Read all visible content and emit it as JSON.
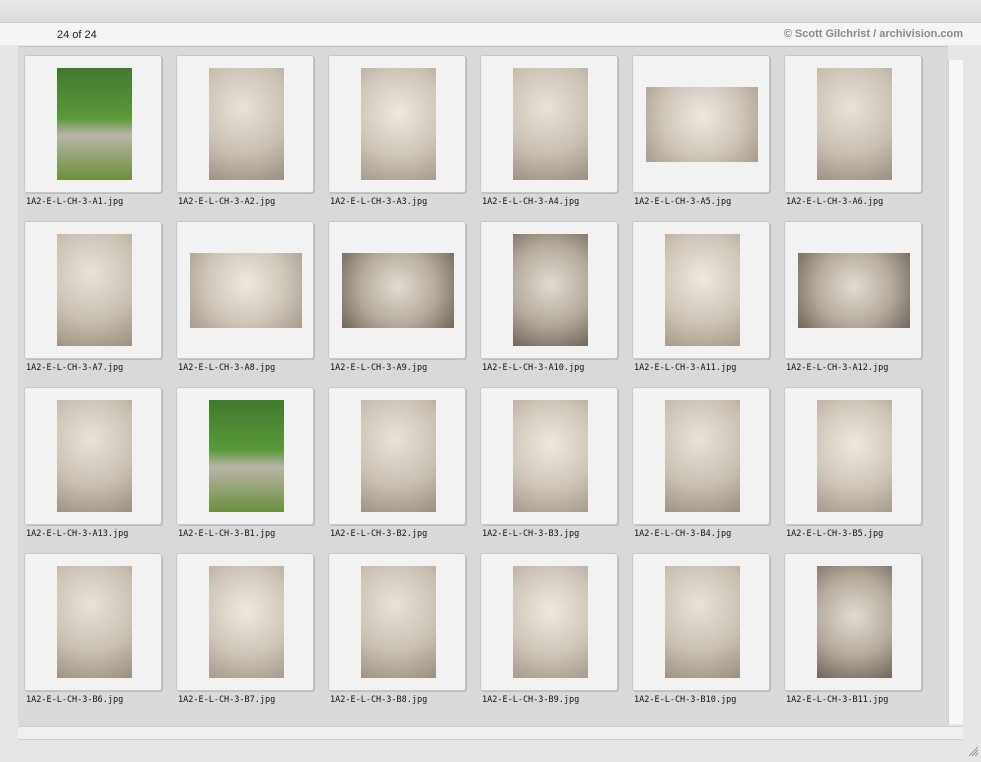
{
  "header": {
    "count": "24 of 24",
    "credit": "© Scott Gilchrist / archivision.com"
  },
  "grid": {
    "items": [
      {
        "filename": "1A2-E-L-CH-3-A1.jpg",
        "thumb": "urn-garden-photo"
      },
      {
        "filename": "1A2-E-L-CH-3-A2.jpg",
        "thumb": "relief-photo"
      },
      {
        "filename": "1A2-E-L-CH-3-A3.jpg",
        "thumb": "relief-photo"
      },
      {
        "filename": "1A2-E-L-CH-3-A4.jpg",
        "thumb": "relief-photo"
      },
      {
        "filename": "1A2-E-L-CH-3-A5.jpg",
        "thumb": "relief-photo"
      },
      {
        "filename": "1A2-E-L-CH-3-A6.jpg",
        "thumb": "relief-photo"
      },
      {
        "filename": "1A2-E-L-CH-3-A7.jpg",
        "thumb": "relief-photo"
      },
      {
        "filename": "1A2-E-L-CH-3-A8.jpg",
        "thumb": "relief-photo"
      },
      {
        "filename": "1A2-E-L-CH-3-A9.jpg",
        "thumb": "relief-photo"
      },
      {
        "filename": "1A2-E-L-CH-3-A10.jpg",
        "thumb": "relief-photo"
      },
      {
        "filename": "1A2-E-L-CH-3-A11.jpg",
        "thumb": "relief-photo"
      },
      {
        "filename": "1A2-E-L-CH-3-A12.jpg",
        "thumb": "relief-photo"
      },
      {
        "filename": "1A2-E-L-CH-3-A13.jpg",
        "thumb": "relief-photo"
      },
      {
        "filename": "1A2-E-L-CH-3-B1.jpg",
        "thumb": "urn-garden-photo"
      },
      {
        "filename": "1A2-E-L-CH-3-B2.jpg",
        "thumb": "relief-photo"
      },
      {
        "filename": "1A2-E-L-CH-3-B3.jpg",
        "thumb": "relief-photo"
      },
      {
        "filename": "1A2-E-L-CH-3-B4.jpg",
        "thumb": "relief-photo"
      },
      {
        "filename": "1A2-E-L-CH-3-B5.jpg",
        "thumb": "relief-photo"
      },
      {
        "filename": "1A2-E-L-CH-3-B6.jpg",
        "thumb": "relief-photo"
      },
      {
        "filename": "1A2-E-L-CH-3-B7.jpg",
        "thumb": "relief-photo"
      },
      {
        "filename": "1A2-E-L-CH-3-B8.jpg",
        "thumb": "relief-photo"
      },
      {
        "filename": "1A2-E-L-CH-3-B9.jpg",
        "thumb": "relief-photo"
      },
      {
        "filename": "1A2-E-L-CH-3-B10.jpg",
        "thumb": "relief-photo"
      },
      {
        "filename": "1A2-E-L-CH-3-B11.jpg",
        "thumb": "relief-photo"
      }
    ]
  }
}
